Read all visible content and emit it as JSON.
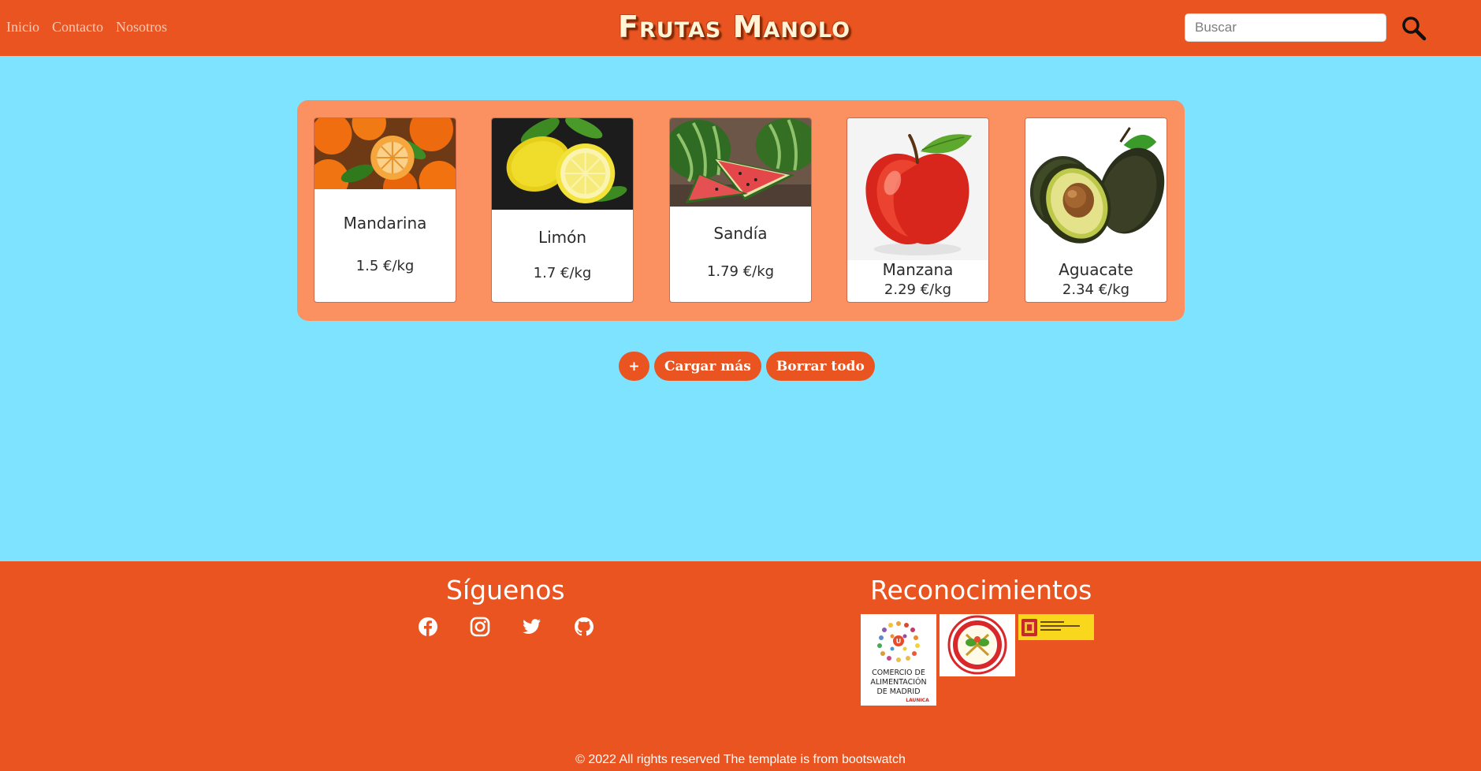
{
  "nav": {
    "links": [
      "Inicio",
      "Contacto",
      "Nosotros"
    ],
    "brand": "Frutas Manolo",
    "search_placeholder": "Buscar",
    "search_icon": "search-icon"
  },
  "products": [
    {
      "name": "Mandarina",
      "price": "1.5 €/kg",
      "image": "mandarin-image"
    },
    {
      "name": "Limón",
      "price": "1.7 €/kg",
      "image": "lemon-image"
    },
    {
      "name": "Sandía",
      "price": "1.79 €/kg",
      "image": "watermelon-image"
    },
    {
      "name": "Manzana",
      "price": "2.29 €/kg",
      "image": "apple-image"
    },
    {
      "name": "Aguacate",
      "price": "2.34 €/kg",
      "image": "avocado-image"
    }
  ],
  "actions": {
    "add_label": "+",
    "load_more_label": "Cargar más",
    "clear_label": "Borrar todo"
  },
  "footer": {
    "follow_title": "Síguenos",
    "social_icons": [
      "facebook-icon",
      "instagram-icon",
      "twitter-icon",
      "github-icon"
    ],
    "awards_title": "Reconocimientos",
    "award_logo_text": [
      "COMERCIO DE",
      "ALIMENTACIÓN",
      "DE MADRID"
    ],
    "copyright": "© 2022 All rights reserved The template is from bootswatch"
  },
  "colors": {
    "primary": "#e95420",
    "background": "#7ee3ff",
    "panel": "#fb9060"
  }
}
